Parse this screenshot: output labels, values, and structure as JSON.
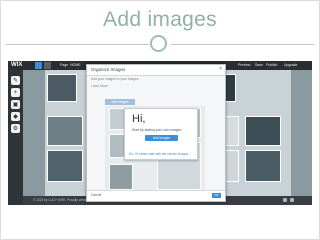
{
  "slide": {
    "title": "Add images"
  },
  "editor": {
    "logo": "WIX",
    "topbar": {
      "page_label": "Page",
      "page_value": "HOME",
      "preview": "Preview",
      "save": "Save",
      "publish": "Publish",
      "upgrade": "Upgrade"
    },
    "toolbar_icons": [
      "pencil-icon",
      "add-icon",
      "image-icon",
      "app-icon",
      "settings-icon"
    ],
    "bottom_text": "© 2023 by LUCY KIRK. Proudly created with Wix.com"
  },
  "modal": {
    "title": "Organize Images",
    "close": "×",
    "search_placeholder": "Add your images to your Images",
    "sub_text": "Learn More",
    "tab_label": "Add Images",
    "cancel": "Cancel",
    "ok": "OK"
  },
  "popup": {
    "greeting": "Hi,",
    "text": "Start by adding your own images",
    "button": "Add Images",
    "link": "No, I'd rather start with the current images"
  },
  "colors": {
    "accent": "#3b8fd8",
    "title": "#8fb1a9"
  }
}
